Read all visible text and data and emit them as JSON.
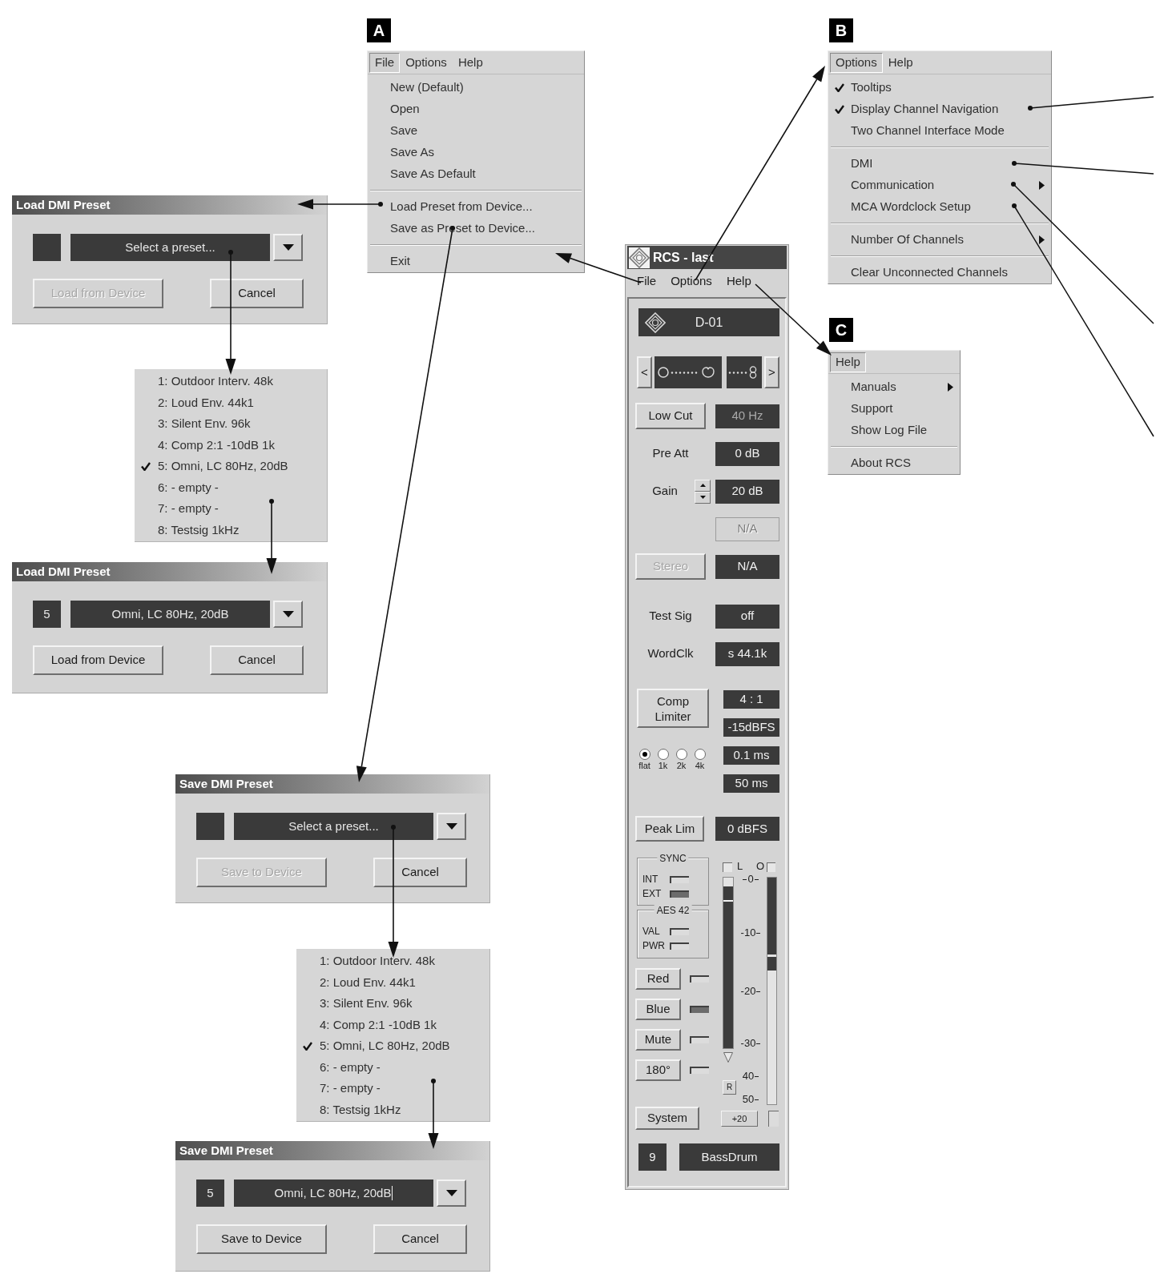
{
  "file_menu": {
    "callout": "A",
    "menubar": [
      {
        "label": "File",
        "selected": true
      },
      {
        "label": "Options",
        "selected": false
      },
      {
        "label": "Help",
        "selected": false
      }
    ],
    "groups": [
      [
        {
          "label": "New (Default)"
        },
        {
          "label": "Open"
        },
        {
          "label": "Save"
        },
        {
          "label": "Save As"
        },
        {
          "label": "Save As Default"
        }
      ],
      [
        {
          "label": "Load Preset from Device..."
        },
        {
          "label": "Save as Preset to Device..."
        }
      ],
      [
        {
          "label": "Exit"
        }
      ]
    ]
  },
  "load_preset_dialog": {
    "title": "Load DMI Preset",
    "preset_field": {
      "placeholder": "Select a preset...",
      "focused": false
    },
    "buttons": [
      {
        "label": "Load from Device",
        "disabled": true
      },
      {
        "label": "Cancel",
        "disabled": false
      }
    ]
  },
  "load_preset_list": {
    "items": [
      {
        "label": "1: Outdoor Interv. 48k",
        "checked": false
      },
      {
        "label": "2: Loud Env. 44k1",
        "checked": false
      },
      {
        "label": "3: Silent Env. 96k",
        "checked": false
      },
      {
        "label": "4: Comp 2:1 -10dB 1k",
        "checked": false
      },
      {
        "label": "5: Omni, LC 80Hz, 20dB",
        "checked": true
      },
      {
        "label": "6: - empty -",
        "checked": false
      },
      {
        "label": "7: - empty -",
        "checked": false
      },
      {
        "label": "8: Testsig 1kHz",
        "checked": false
      }
    ]
  },
  "load_preset_dialog_filled": {
    "title": "Load DMI Preset",
    "preset_number": "5",
    "preset_field": {
      "value": "Omni, LC 80Hz, 20dB",
      "focused": false
    },
    "buttons": [
      {
        "label": "Load from Device",
        "disabled": false
      },
      {
        "label": "Cancel",
        "disabled": false
      }
    ]
  },
  "save_preset_dialog": {
    "title": "Save DMI Preset",
    "preset_field": {
      "placeholder": "Select a preset...",
      "focused": false
    },
    "buttons": [
      {
        "label": "Save to Device",
        "disabled": true
      },
      {
        "label": "Cancel",
        "disabled": false
      }
    ]
  },
  "save_preset_list": {
    "items": [
      {
        "label": "1: Outdoor Interv. 48k",
        "checked": false
      },
      {
        "label": "2: Loud Env. 44k1",
        "checked": false
      },
      {
        "label": "3: Silent Env. 96k",
        "checked": false
      },
      {
        "label": "4: Comp 2:1 -10dB 1k",
        "checked": false
      },
      {
        "label": "5: Omni, LC 80Hz, 20dB",
        "checked": true
      },
      {
        "label": "6: - empty -",
        "checked": false
      },
      {
        "label": "7: - empty -",
        "checked": false
      },
      {
        "label": "8: Testsig 1kHz",
        "checked": false
      }
    ]
  },
  "save_preset_dialog_filled": {
    "title": "Save DMI Preset",
    "preset_number": "5",
    "preset_field": {
      "value": "Omni, LC 80Hz, 20dB",
      "focused": true
    },
    "buttons": [
      {
        "label": "Save to Device",
        "disabled": false
      },
      {
        "label": "Cancel",
        "disabled": false
      }
    ]
  },
  "rcs_window": {
    "title": "RCS - last",
    "menubar": [
      "File",
      "Options",
      "Help"
    ],
    "device": "D-01",
    "pattern": {
      "prev": "<",
      "next": ">",
      "level": 0.63
    },
    "row_groups": [
      [
        {
          "kind": "button",
          "label": "Low Cut",
          "disabled": false,
          "value": "40 Hz",
          "value_dimmed": true,
          "value_disabled": false
        },
        {
          "kind": "label",
          "label": "Pre Att",
          "disabled": false,
          "value": "0 dB",
          "value_dimmed": false,
          "value_disabled": false
        },
        {
          "kind": "spinner",
          "label": "Gain",
          "disabled": false,
          "value": "20 dB",
          "value_dimmed": false,
          "value_disabled": false
        },
        {
          "kind": "blank",
          "value": "N/A",
          "value_dimmed": false,
          "value_disabled": true
        },
        {
          "kind": "button",
          "label": "Stereo",
          "disabled": true,
          "value": "N/A",
          "value_dimmed": false,
          "value_disabled": false
        }
      ],
      [
        {
          "kind": "label",
          "label": "Test Sig",
          "disabled": false,
          "value": "off",
          "value_dimmed": false,
          "value_disabled": false
        },
        {
          "kind": "label",
          "label": "WordClk",
          "disabled": false,
          "value": "s 44.1k",
          "value_dimmed": false,
          "value_disabled": false
        }
      ]
    ],
    "compressor": {
      "label": "Comp Limiter",
      "values": [
        "4 : 1",
        "-15dBFS",
        "0.1 ms",
        "50 ms"
      ],
      "filters": [
        {
          "label": "flat",
          "selected": true
        },
        {
          "label": "1k",
          "selected": false
        },
        {
          "label": "2k",
          "selected": false
        },
        {
          "label": "4k",
          "selected": false
        }
      ]
    },
    "peak_limiter": {
      "label": "Peak Lim",
      "value": "0 dBFS"
    },
    "status_groups": [
      {
        "title": "SYNC",
        "leds": [
          {
            "label": "INT",
            "on": false
          },
          {
            "label": "EXT",
            "on": true
          }
        ]
      },
      {
        "title": "AES 42",
        "leds": [
          {
            "label": "VAL",
            "on": false
          },
          {
            "label": "PWR",
            "on": false
          }
        ]
      }
    ],
    "toggles": [
      {
        "label": "Red",
        "on": false
      },
      {
        "label": "Blue",
        "on": true
      },
      {
        "label": "Mute",
        "on": false
      },
      {
        "label": "180°",
        "on": false
      }
    ],
    "system_button": "System",
    "meters": [
      {
        "kind": "input",
        "label": "L",
        "level": 0.95
      },
      {
        "kind": "reduction",
        "label": "O",
        "level": 0.34
      }
    ],
    "scale": [
      "0",
      "-10",
      "-20",
      "-30",
      "40",
      "50"
    ],
    "reset_button": "R",
    "boost_button": "+20",
    "channel": {
      "number": "9",
      "name": "BassDrum"
    }
  },
  "options_menu": {
    "callout": "B",
    "menubar": [
      {
        "label": "Options",
        "selected": true
      },
      {
        "label": "Help",
        "selected": false
      }
    ],
    "groups": [
      [
        {
          "label": "Tooltips",
          "checked": true,
          "submenu": false
        },
        {
          "label": "Display Channel Navigation",
          "checked": true,
          "submenu": false
        },
        {
          "label": "Two Channel Interface Mode",
          "checked": false,
          "submenu": false
        }
      ],
      [
        {
          "label": "DMI",
          "checked": false,
          "submenu": false
        },
        {
          "label": "Communication",
          "checked": false,
          "submenu": true
        },
        {
          "label": "MCA Wordclock Setup",
          "checked": false,
          "submenu": false
        }
      ],
      [
        {
          "label": "Number Of Channels",
          "checked": false,
          "submenu": true
        }
      ],
      [
        {
          "label": "Clear Unconnected Channels",
          "checked": false,
          "submenu": false
        }
      ]
    ]
  },
  "help_menu": {
    "callout": "C",
    "menubar": [
      {
        "label": "Help",
        "selected": true
      }
    ],
    "groups": [
      [
        {
          "label": "Manuals",
          "submenu": true
        },
        {
          "label": "Support",
          "submenu": false
        },
        {
          "label": "Show Log File",
          "submenu": false
        }
      ],
      [
        {
          "label": "About RCS",
          "submenu": false
        }
      ]
    ]
  }
}
